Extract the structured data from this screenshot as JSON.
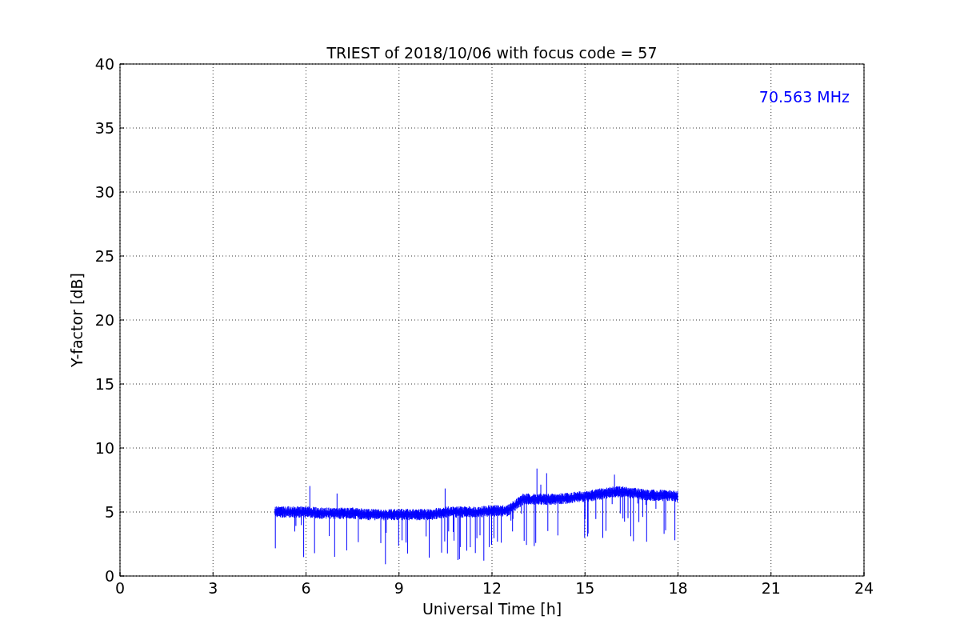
{
  "chart_data": {
    "type": "line",
    "title": "TRIEST of 2018/10/06 with focus code = 57",
    "xlabel": "Universal Time [h]",
    "ylabel": "Y-factor [dB]",
    "xlim": [
      0,
      24
    ],
    "ylim": [
      0,
      40
    ],
    "xticks": [
      0,
      3,
      6,
      9,
      12,
      15,
      18,
      21,
      24
    ],
    "yticks": [
      0,
      5,
      10,
      15,
      20,
      25,
      30,
      35,
      40
    ],
    "grid": true,
    "x": [
      5,
      5.5,
      6,
      6.5,
      7,
      7.5,
      8,
      8.5,
      9,
      9.5,
      10,
      10.5,
      11,
      11.5,
      12,
      12.5,
      13,
      13.5,
      14,
      14.5,
      15,
      15.5,
      16,
      16.5,
      17,
      17.5,
      18
    ],
    "series": [
      {
        "name": "70.563 MHz",
        "color": "#0000ff",
        "values": [
          5.0,
          5.0,
          5.0,
          4.9,
          4.9,
          4.9,
          4.8,
          4.8,
          4.8,
          4.8,
          4.8,
          5.0,
          5.0,
          5.0,
          5.1,
          5.1,
          6.0,
          6.0,
          6.0,
          6.1,
          6.2,
          6.4,
          6.6,
          6.5,
          6.3,
          6.3,
          6.2
        ]
      }
    ]
  }
}
